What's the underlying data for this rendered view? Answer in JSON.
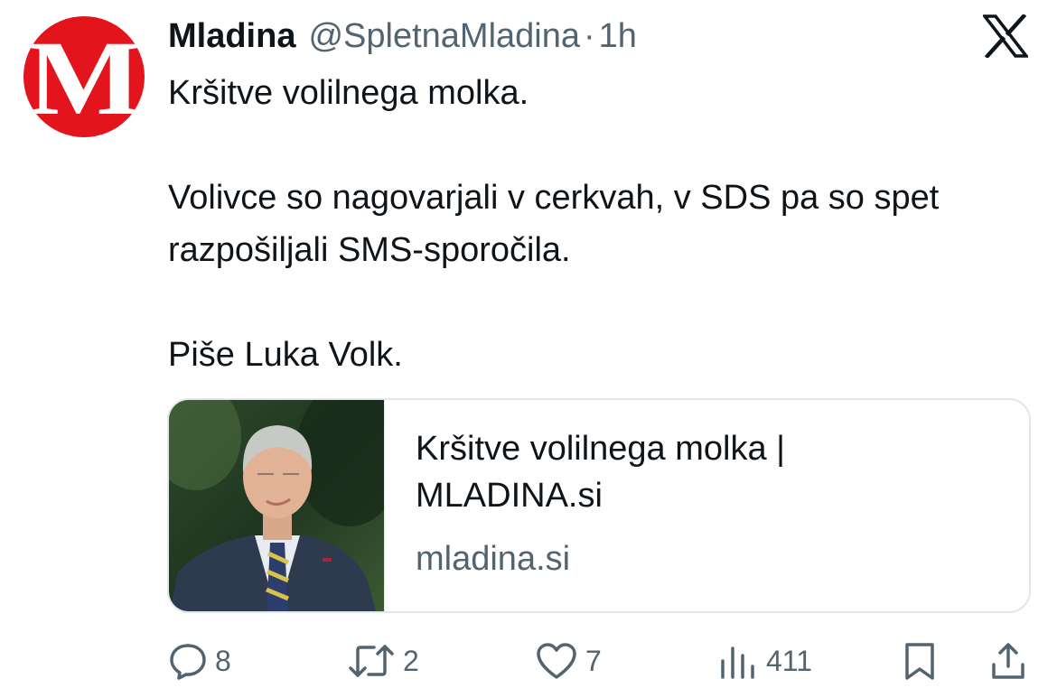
{
  "tweet": {
    "author_name": "Mladina",
    "handle": "@SpletnaMladina",
    "separator": "·",
    "time": "1h",
    "avatar_letter": "M",
    "avatar_color": "#e4141d",
    "paragraphs": [
      "Kršitve volilnega molka.",
      "Volivce so nagovarjali v cerkvah, v SDS pa so spet razpošiljali SMS-sporočila.",
      "Piše Luka Volk."
    ]
  },
  "card": {
    "title": "Kršitve volilnega molka | MLADINA.si",
    "domain": "mladina.si",
    "image": "portrait-photo"
  },
  "actions": {
    "replies": "8",
    "reposts": "2",
    "likes": "7",
    "views": "411"
  },
  "icons": {
    "logo": "x-logo-icon",
    "reply": "reply-icon",
    "repost": "repost-icon",
    "like": "heart-icon",
    "views": "views-icon",
    "bookmark": "bookmark-icon",
    "share": "share-icon"
  },
  "colors": {
    "text": "#0f1419",
    "secondary": "#536471",
    "brand_red": "#e4141d"
  }
}
